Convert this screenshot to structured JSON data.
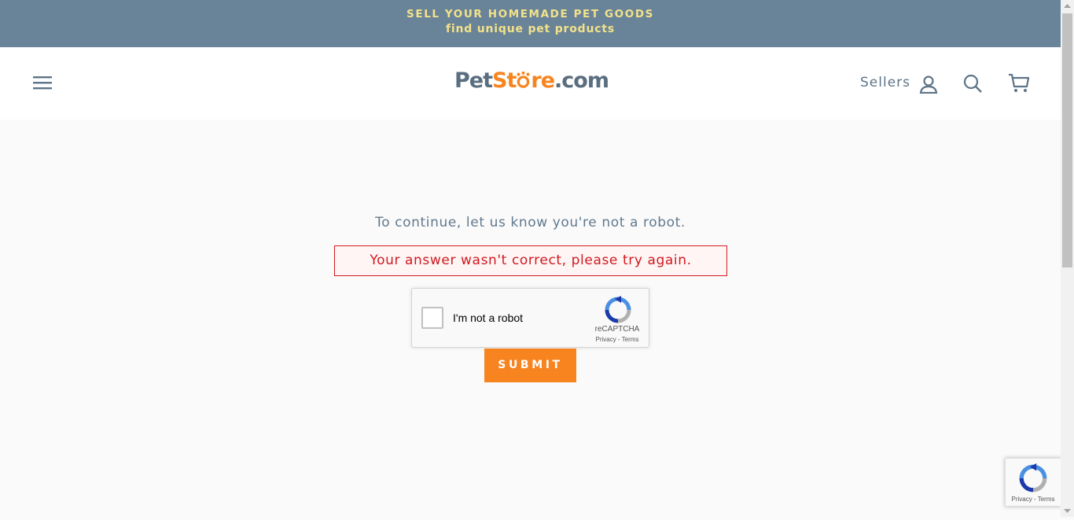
{
  "announcement": {
    "line1": "SELL YOUR HOMEMADE PET GOODS",
    "line2": "find unique pet products"
  },
  "header": {
    "logo": {
      "part1": "Pet",
      "part2": "St",
      "part3": "re",
      "part4": ".com"
    },
    "sellers_label": "Sellers",
    "icons": [
      "hamburger-menu-icon",
      "user-icon",
      "search-icon",
      "cart-icon"
    ]
  },
  "main": {
    "prompt": "To continue, let us know you're not a robot.",
    "error": "Your answer wasn't correct, please try again.",
    "captcha": {
      "label": "I'm not a robot",
      "brand": "reCAPTCHA",
      "links": "Privacy - Terms"
    },
    "submit_label": "SUBMIT"
  },
  "badge": {
    "links": "Privacy - Terms"
  },
  "colors": {
    "announcement_bg": "#698398",
    "announcement_text": "#f3e28a",
    "accent": "#f7841e",
    "error": "#d0191f",
    "text": "#61798e"
  }
}
